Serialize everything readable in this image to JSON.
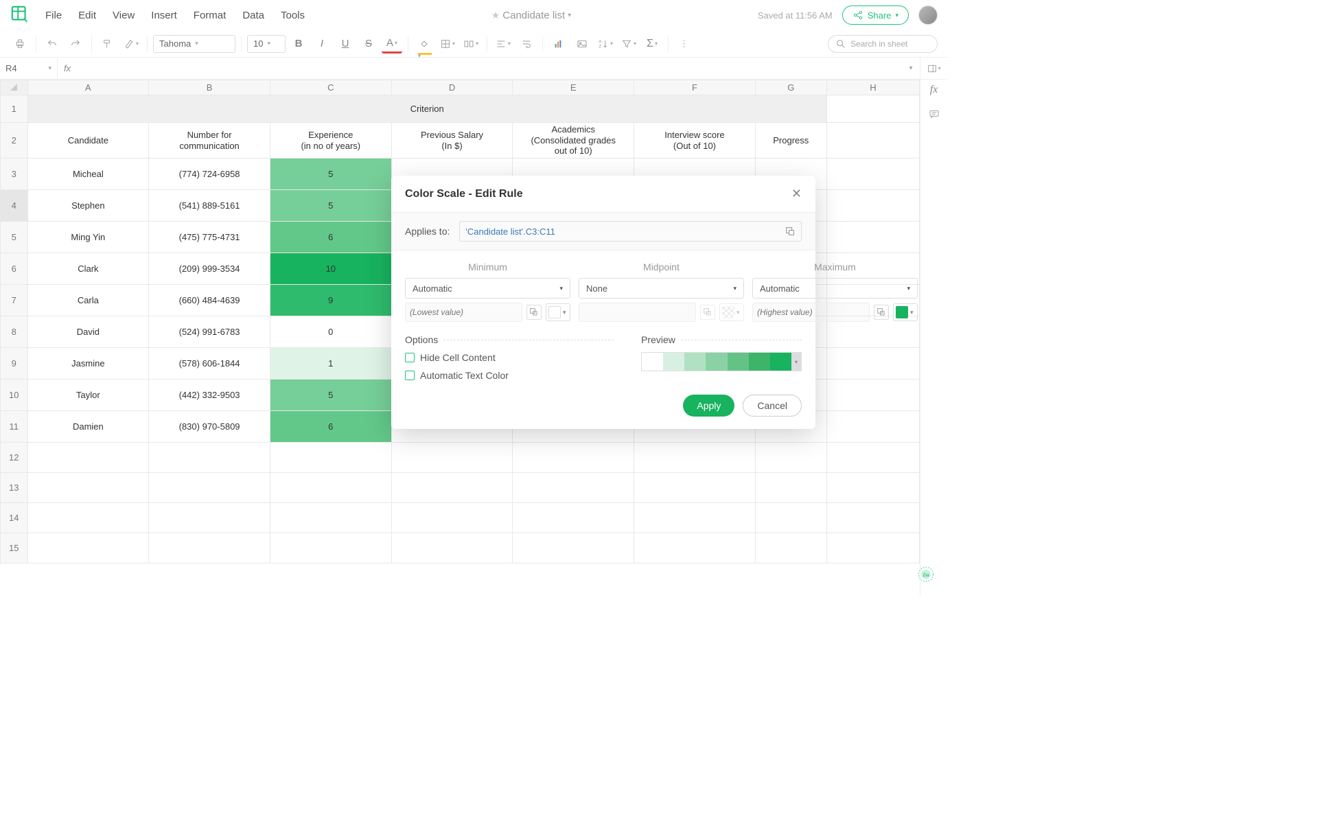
{
  "app": {
    "title": "Candidate list",
    "saved_status": "Saved at 11:56 AM",
    "share_label": "Share"
  },
  "menu": [
    "File",
    "Edit",
    "View",
    "Insert",
    "Format",
    "Data",
    "Tools"
  ],
  "toolbar": {
    "font_family": "Tahoma",
    "font_size": "10",
    "search_placeholder": "Search in sheet"
  },
  "name_box": "R4",
  "formula": "",
  "columns": [
    "A",
    "B",
    "C",
    "D",
    "E",
    "F",
    "G",
    "H"
  ],
  "row_numbers": [
    "1",
    "2",
    "3",
    "4",
    "5",
    "6",
    "7",
    "8",
    "9",
    "10",
    "11",
    "12",
    "13",
    "14",
    "15"
  ],
  "sheet": {
    "title": "Criterion",
    "headers": {
      "candidate": "Candidate",
      "number": "Number for\ncommunication",
      "experience": "Experience\n(in no of years)",
      "salary": "Previous Salary\n(In $)",
      "academics": "Academics\n(Consolidated grades\nout of 10)",
      "interview": "Interview score\n(Out of 10)",
      "progress": "Progress"
    },
    "rows": [
      {
        "candidate": "Micheal",
        "number": "(774) 724-6958",
        "exp": "5",
        "bg": "#76cf98"
      },
      {
        "candidate": "Stephen",
        "number": "(541) 889-5161",
        "exp": "5",
        "bg": "#76cf98"
      },
      {
        "candidate": "Ming Yin",
        "number": "(475) 775-4731",
        "exp": "6",
        "bg": "#62c889"
      },
      {
        "candidate": "Clark",
        "number": "(209) 999-3534",
        "exp": "10",
        "bg": "#17b35f"
      },
      {
        "candidate": "Carla",
        "number": "(660) 484-4639",
        "exp": "9",
        "bg": "#2fbb6d"
      },
      {
        "candidate": "David",
        "number": "(524) 991-6783",
        "exp": "0",
        "bg": "#ffffff"
      },
      {
        "candidate": "Jasmine",
        "number": "(578) 606-1844",
        "exp": "1",
        "bg": "#e0f3e7"
      },
      {
        "candidate": "Taylor",
        "number": "(442) 332-9503",
        "exp": "5",
        "bg": "#76cf98"
      },
      {
        "candidate": "Damien",
        "number": "(830) 970-5809",
        "exp": "6",
        "bg": "#62c889"
      }
    ]
  },
  "dialog": {
    "title": "Color Scale - Edit Rule",
    "applies_label": "Applies to:",
    "applies_value": "'Candidate list'.C3:C11",
    "min_label": "Minimum",
    "mid_label": "Midpoint",
    "max_label": "Maximum",
    "min_type": "Automatic",
    "mid_type": "None",
    "max_type": "Automatic",
    "min_placeholder": "(Lowest value)",
    "max_placeholder": "(Highest value)",
    "options_label": "Options",
    "hide_label": "Hide Cell Content",
    "auto_text_label": "Automatic Text Color",
    "preview_label": "Preview",
    "preview_colors": [
      "#ffffff",
      "#d8f0e1",
      "#b1e1c3",
      "#8ad2a5",
      "#63c387",
      "#3cb469",
      "#17b35f"
    ],
    "apply": "Apply",
    "cancel": "Cancel"
  }
}
